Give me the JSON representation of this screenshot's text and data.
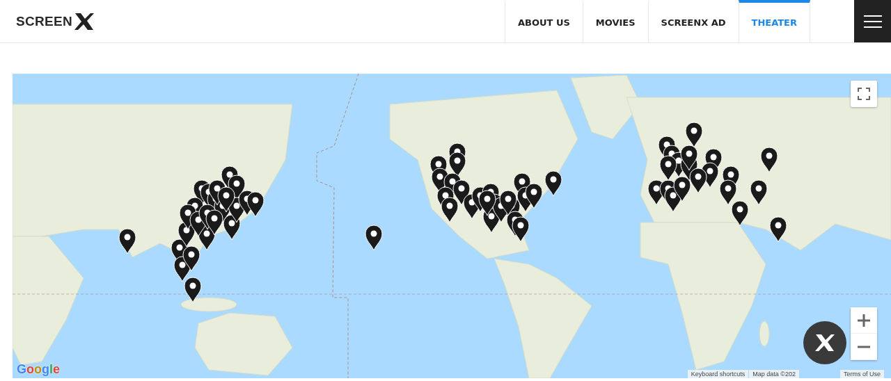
{
  "header": {
    "logo": "SCREEN",
    "nav": [
      {
        "label": "ABOUT US",
        "selected": false
      },
      {
        "label": "MOVIES",
        "selected": false
      },
      {
        "label": "SCREENX AD",
        "selected": false
      },
      {
        "label": "THEATER",
        "selected": true
      }
    ]
  },
  "map": {
    "google_logo": "Google",
    "attribution": [
      "Keyboard shortcuts",
      "Map data ©202",
      "Terms of Use"
    ]
  }
}
